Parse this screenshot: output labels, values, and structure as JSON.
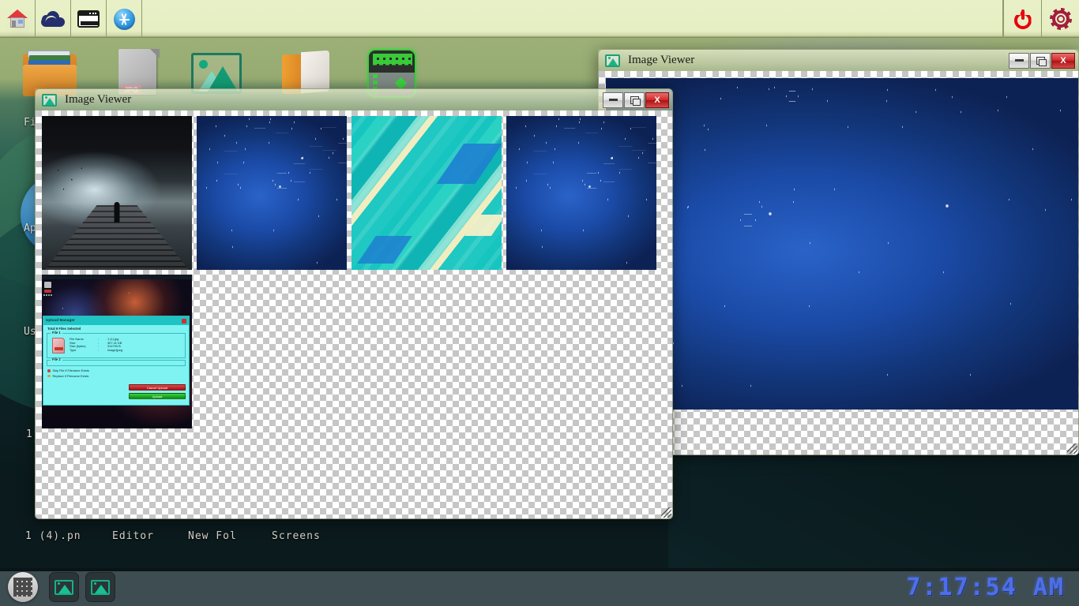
{
  "topbar": {
    "left_buttons": [
      {
        "name": "home-icon",
        "label": "Home"
      },
      {
        "name": "cloud-icon",
        "label": "Cloud"
      },
      {
        "name": "window-icon",
        "label": "Windows"
      },
      {
        "name": "app-store-icon",
        "label": "App Store"
      }
    ],
    "right_buttons": [
      {
        "name": "power-icon",
        "label": "Power"
      },
      {
        "name": "settings-gear-icon",
        "label": "Settings"
      }
    ]
  },
  "desktop": {
    "icons": [
      {
        "name": "folder-documents-icon",
        "label": "Fi"
      },
      {
        "name": "jpg-file-icon",
        "label": "Ap",
        "badge": "JPG"
      },
      {
        "name": "image-viewer-icon",
        "label": "Us"
      },
      {
        "name": "folder-icon",
        "label": "1"
      },
      {
        "name": "matrix-app-icon",
        "label": ""
      }
    ],
    "bottom_labels": [
      "1 (4).pn",
      "Editor",
      "New Fol",
      "Screens"
    ]
  },
  "windows": [
    {
      "id": "back-window",
      "title": "Image Viewer",
      "controls": {
        "minimize": "–",
        "maximize": "❐",
        "close": "X"
      }
    },
    {
      "id": "front-window",
      "title": "Image Viewer",
      "controls": {
        "minimize": "–",
        "maximize": "❐",
        "close": "X"
      },
      "thumbnails": [
        {
          "name": "thumbnail-foggy-pier",
          "kind": "photo"
        },
        {
          "name": "thumbnail-blue-hexagons-1",
          "kind": "wallpaper"
        },
        {
          "name": "thumbnail-teal-diagonal",
          "kind": "wallpaper"
        },
        {
          "name": "thumbnail-blue-hexagons-2",
          "kind": "wallpaper"
        },
        {
          "name": "thumbnail-upload-manager-screenshot",
          "kind": "screenshot"
        }
      ]
    }
  ],
  "upload_manager_thumb": {
    "title": "Upload Manager",
    "close_label": "x",
    "subtitle": "Total 9 Files Selected",
    "file1_legend": "File 1",
    "file2_legend": "File 2",
    "rows": [
      {
        "key": "File Name",
        "colon": ":",
        "value": "1 (1).jpg"
      },
      {
        "key": "Size",
        "colon": ":",
        "value": "307.41 KB"
      },
      {
        "key": "Size (bytes)",
        "colon": ":",
        "value": "314790 B"
      },
      {
        "key": "Type",
        "colon": ":",
        "value": "image/jpeg"
      }
    ],
    "options": [
      {
        "label": "Skip File if Filename Exists"
      },
      {
        "label": "Replace if Filename Exists"
      }
    ],
    "buttons": {
      "cancel": "Cancel Upload",
      "upload": "Upload"
    }
  },
  "taskbar": {
    "launcher_name": "app-launcher-grid-icon",
    "tasks": [
      {
        "name": "taskbar-image-viewer-1",
        "label": "Image Viewer"
      },
      {
        "name": "taskbar-image-viewer-2",
        "label": "Image Viewer"
      }
    ],
    "clock": "7:17:54 AM"
  },
  "colors": {
    "topbar_bg": "#e9f0c8",
    "power_red": "#e8000d",
    "gear_maroon": "#a31d3c",
    "taskbar_bg": "#3e4d52",
    "clock_blue": "#4d6fe8",
    "close_red": "#d22b2b",
    "viewer_green": "#16b086"
  }
}
